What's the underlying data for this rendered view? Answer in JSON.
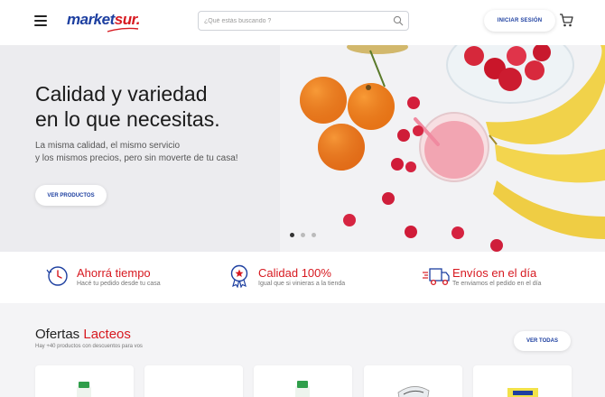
{
  "header": {
    "logo_main": "market",
    "logo_accent": "sur.",
    "search_placeholder": "¿Qué estás buscando ?",
    "login_label": "INICIAR SESIÓN"
  },
  "hero": {
    "title_line1": "Calidad y variedad",
    "title_line2": "en lo que necesitas.",
    "subtitle_line1": "La misma calidad, el mismo servicio",
    "subtitle_line2": "y los mismos precios, pero sin moverte de tu casa!",
    "cta_label": "VER PRODUCTOS",
    "slides": 3,
    "active_slide": 1
  },
  "features": [
    {
      "title": "Ahorrá tiempo",
      "desc": "Hacé tu pedido desde tu casa",
      "icon": "clock-icon"
    },
    {
      "title": "Calidad 100%",
      "desc": "Igual que si vinieras a la tienda",
      "icon": "quality-badge-icon"
    },
    {
      "title": "Envíos en el día",
      "desc": "Te enviamos el pedido en el día",
      "icon": "delivery-truck-icon"
    }
  ],
  "offers": {
    "title_main": "Ofertas",
    "title_accent": "Lacteos",
    "subtitle": "Hay +40 productos con descuentos para vos",
    "see_all_label": "VER TODAS"
  },
  "colors": {
    "brand_blue": "#1d3fa0",
    "brand_red": "#d71920"
  }
}
